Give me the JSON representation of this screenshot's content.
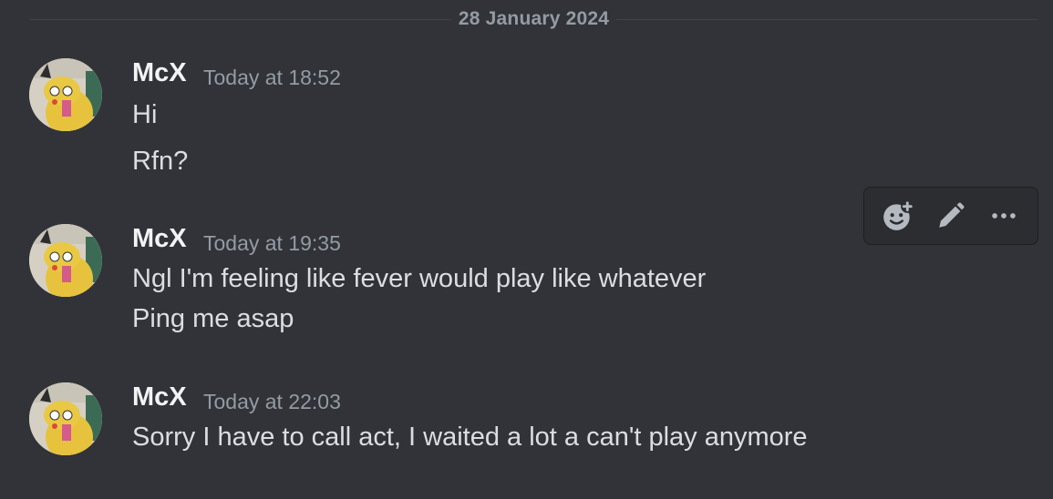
{
  "divider": {
    "date": "28 January 2024"
  },
  "messages": [
    {
      "username": "McX",
      "timestamp": "Today at 18:52",
      "lines": [
        "Hi",
        "Rfn?"
      ]
    },
    {
      "username": "McX",
      "timestamp": "Today at 19:35",
      "lines": [
        "Ngl I'm feeling like fever would play like whatever",
        "Ping me asap"
      ]
    },
    {
      "username": "McX",
      "timestamp": "Today at 22:03",
      "lines": [
        "Sorry I have to call act, I waited a lot a can't play anymore"
      ]
    }
  ],
  "toolbar": {
    "icons": [
      "add-reaction-icon",
      "edit-icon",
      "more-icon"
    ]
  },
  "colors": {
    "background": "#313338",
    "username": "#f2f3f5",
    "timestamp": "#949ba4",
    "text": "#dbdee1",
    "toolbar_bg": "#2b2d31"
  }
}
